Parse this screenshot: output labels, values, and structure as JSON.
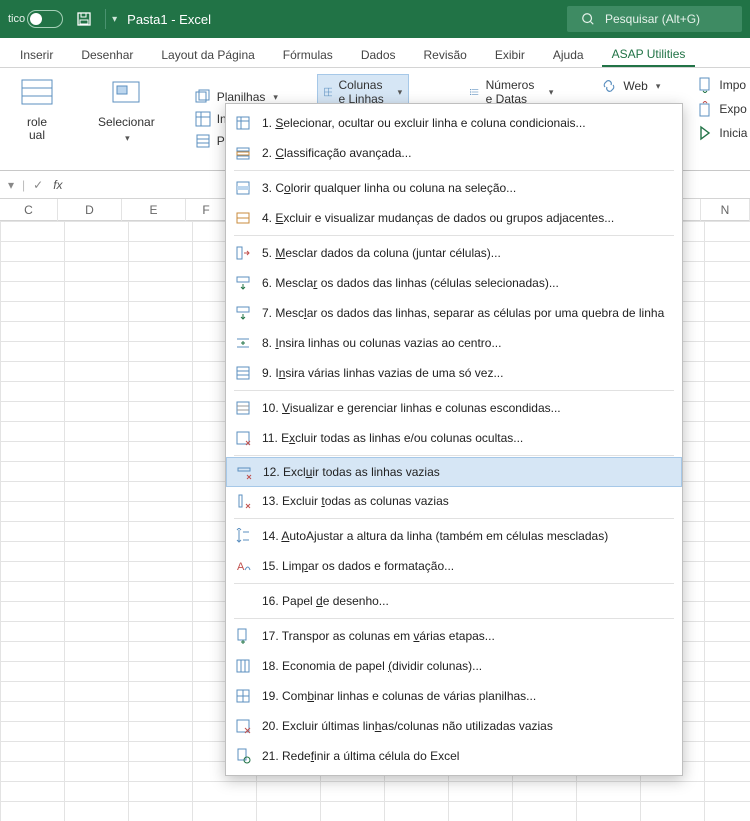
{
  "titlebar": {
    "title": "Pasta1  -  Excel",
    "search_placeholder": "Pesquisar (Alt+G)"
  },
  "tabs": {
    "items": [
      {
        "label": "Inserir"
      },
      {
        "label": "Desenhar"
      },
      {
        "label": "Layout da Página"
      },
      {
        "label": "Fórmulas"
      },
      {
        "label": "Dados"
      },
      {
        "label": "Revisão"
      },
      {
        "label": "Exibir"
      },
      {
        "label": "Ajuda"
      },
      {
        "label": "ASAP Utilities",
        "active": true
      }
    ]
  },
  "ribbon": {
    "left_big_1": "role\nual",
    "left_big_2": "Selecionar",
    "group_planilhas": {
      "items": [
        "Planilhas",
        "Intervalo",
        "Preencher"
      ]
    },
    "btn_colunas": "Colunas e Linhas",
    "btn_numeros": "Números e Datas",
    "btn_web": "Web",
    "right_items": [
      "Impo",
      "Expo",
      "Inicia"
    ]
  },
  "fx": {
    "label": "fx"
  },
  "columns": [
    "C",
    "D",
    "E",
    "F",
    "",
    "",
    "",
    "",
    "",
    "",
    "",
    "N"
  ],
  "menu": {
    "highlighted_index": 11,
    "items": [
      {
        "num": "1.",
        "pre": "",
        "ul": "S",
        "post": "elecionar, ocultar ou excluir linha e coluna condicionais..."
      },
      {
        "num": "2.",
        "pre": "",
        "ul": "C",
        "post": "lassificação avançada..."
      },
      {
        "num": "3.",
        "pre": "C",
        "ul": "o",
        "post": "lorir qualquer linha ou coluna na seleção..."
      },
      {
        "num": "4.",
        "pre": "",
        "ul": "E",
        "post": "xcluir e visualizar mudanças de dados ou grupos adjacentes..."
      },
      {
        "num": "5.",
        "pre": "",
        "ul": "M",
        "post": "esclar dados da coluna (juntar células)..."
      },
      {
        "num": "6.",
        "pre": "Mescla",
        "ul": "r",
        "post": " os dados das linhas (células selecionadas)..."
      },
      {
        "num": "7.",
        "pre": "Mesc",
        "ul": "l",
        "post": "ar os dados das linhas, separar as células por uma quebra de linha"
      },
      {
        "num": "8.",
        "pre": "",
        "ul": "I",
        "post": "nsira linhas ou colunas vazias ao centro..."
      },
      {
        "num": "9.",
        "pre": "I",
        "ul": "n",
        "post": "sira várias linhas vazias de uma só vez..."
      },
      {
        "num": "10.",
        "pre": "",
        "ul": "V",
        "post": "isualizar e gerenciar linhas e colunas escondidas..."
      },
      {
        "num": "11.",
        "pre": "E",
        "ul": "x",
        "post": "cluir todas as linhas e/ou colunas ocultas..."
      },
      {
        "num": "12.",
        "pre": "Excl",
        "ul": "u",
        "post": "ir todas as linhas vazias"
      },
      {
        "num": "13.",
        "pre": "Excluir ",
        "ul": "t",
        "post": "odas as colunas vazias"
      },
      {
        "num": "14.",
        "pre": "",
        "ul": "A",
        "post": "utoAjustar a altura da linha (também em células mescladas)"
      },
      {
        "num": "15.",
        "pre": "Lim",
        "ul": "p",
        "post": "ar os dados e formatação..."
      },
      {
        "num": "16.",
        "pre": "Papel ",
        "ul": "d",
        "post": "e desenho..."
      },
      {
        "num": "17.",
        "pre": "Transpor as colunas em ",
        "ul": "v",
        "post": "árias etapas..."
      },
      {
        "num": "18.",
        "pre": "Economia de papel ",
        "ul": "(",
        "post": "dividir colunas)..."
      },
      {
        "num": "19.",
        "pre": "Com",
        "ul": "b",
        "post": "inar linhas e colunas de várias planilhas..."
      },
      {
        "num": "20.",
        "pre": "Excluir últimas lin",
        "ul": "h",
        "post": "as/colunas não utilizadas vazias"
      },
      {
        "num": "21.",
        "pre": "Rede",
        "ul": "f",
        "post": "inir a última célula do Excel"
      }
    ]
  },
  "colors": {
    "excel_green": "#217346",
    "hover_blue": "#d6e6f5"
  }
}
